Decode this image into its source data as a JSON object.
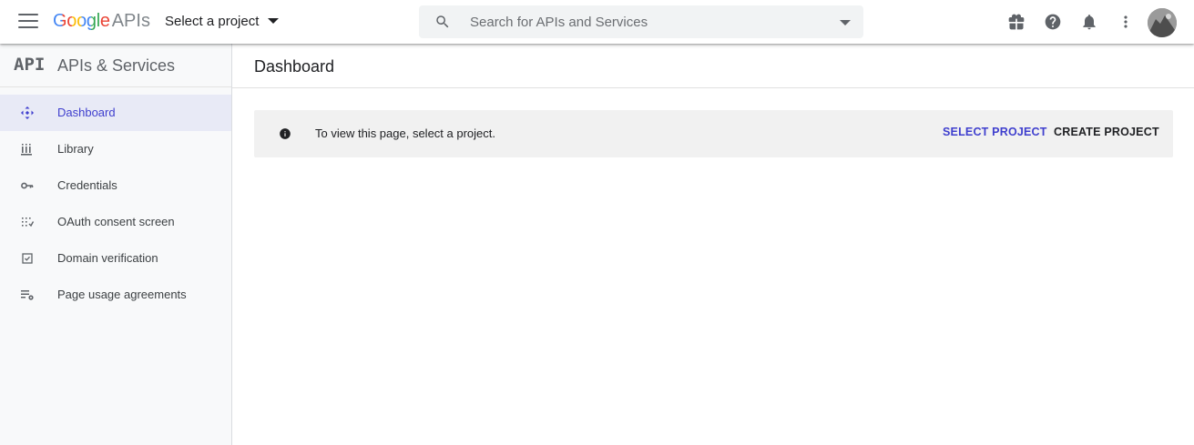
{
  "header": {
    "logo_google": "Google",
    "logo_apis": "APIs",
    "project_selector": "Select a project",
    "search_placeholder": "Search for APIs and Services"
  },
  "sidebar": {
    "logo": "API",
    "title": "APIs & Services",
    "items": [
      {
        "label": "Dashboard",
        "icon": "dashboard-icon",
        "active": true
      },
      {
        "label": "Library",
        "icon": "library-icon",
        "active": false
      },
      {
        "label": "Credentials",
        "icon": "key-icon",
        "active": false
      },
      {
        "label": "OAuth consent screen",
        "icon": "oauth-icon",
        "active": false
      },
      {
        "label": "Domain verification",
        "icon": "domain-check-icon",
        "active": false
      },
      {
        "label": "Page usage agreements",
        "icon": "page-usage-icon",
        "active": false
      }
    ]
  },
  "main": {
    "title": "Dashboard",
    "banner": {
      "message": "To view this page, select a project.",
      "select_button": "SELECT PROJECT",
      "create_button": "CREATE PROJECT"
    }
  },
  "colors": {
    "accent": "#3f3fce",
    "active_bg": "#e8eaf6",
    "sidebar_bg": "#f8f9fa",
    "banner_bg": "#f1f1f1"
  },
  "icons": [
    "menu-icon",
    "search-icon",
    "gift-icon",
    "help-icon",
    "notifications-icon",
    "more-vert-icon",
    "info-icon"
  ]
}
